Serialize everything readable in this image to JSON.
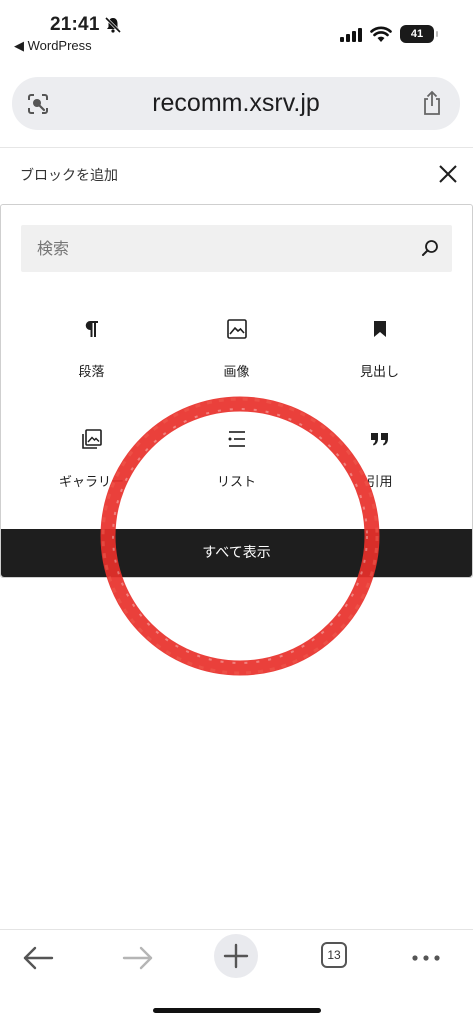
{
  "status_bar": {
    "time": "21:41",
    "back_app": "◀ WordPress",
    "battery": "41"
  },
  "browser": {
    "url": "recomm.xsrv.jp",
    "tab_count": "13"
  },
  "inserter": {
    "title": "ブロックを追加",
    "search_placeholder": "検索",
    "blocks": [
      {
        "label": "段落",
        "icon": "paragraph-icon"
      },
      {
        "label": "画像",
        "icon": "image-icon"
      },
      {
        "label": "見出し",
        "icon": "heading-bookmark-icon"
      },
      {
        "label": "ギャラリー",
        "icon": "gallery-icon"
      },
      {
        "label": "リスト",
        "icon": "list-icon"
      },
      {
        "label": "引用",
        "icon": "quote-icon"
      }
    ],
    "show_all_label": "すべて表示"
  },
  "colors": {
    "accent_dark": "#1e1e1e",
    "url_bar_bg": "#ecedf0",
    "search_bg": "#f0f0f0",
    "stamp_red": "#e8302a"
  }
}
